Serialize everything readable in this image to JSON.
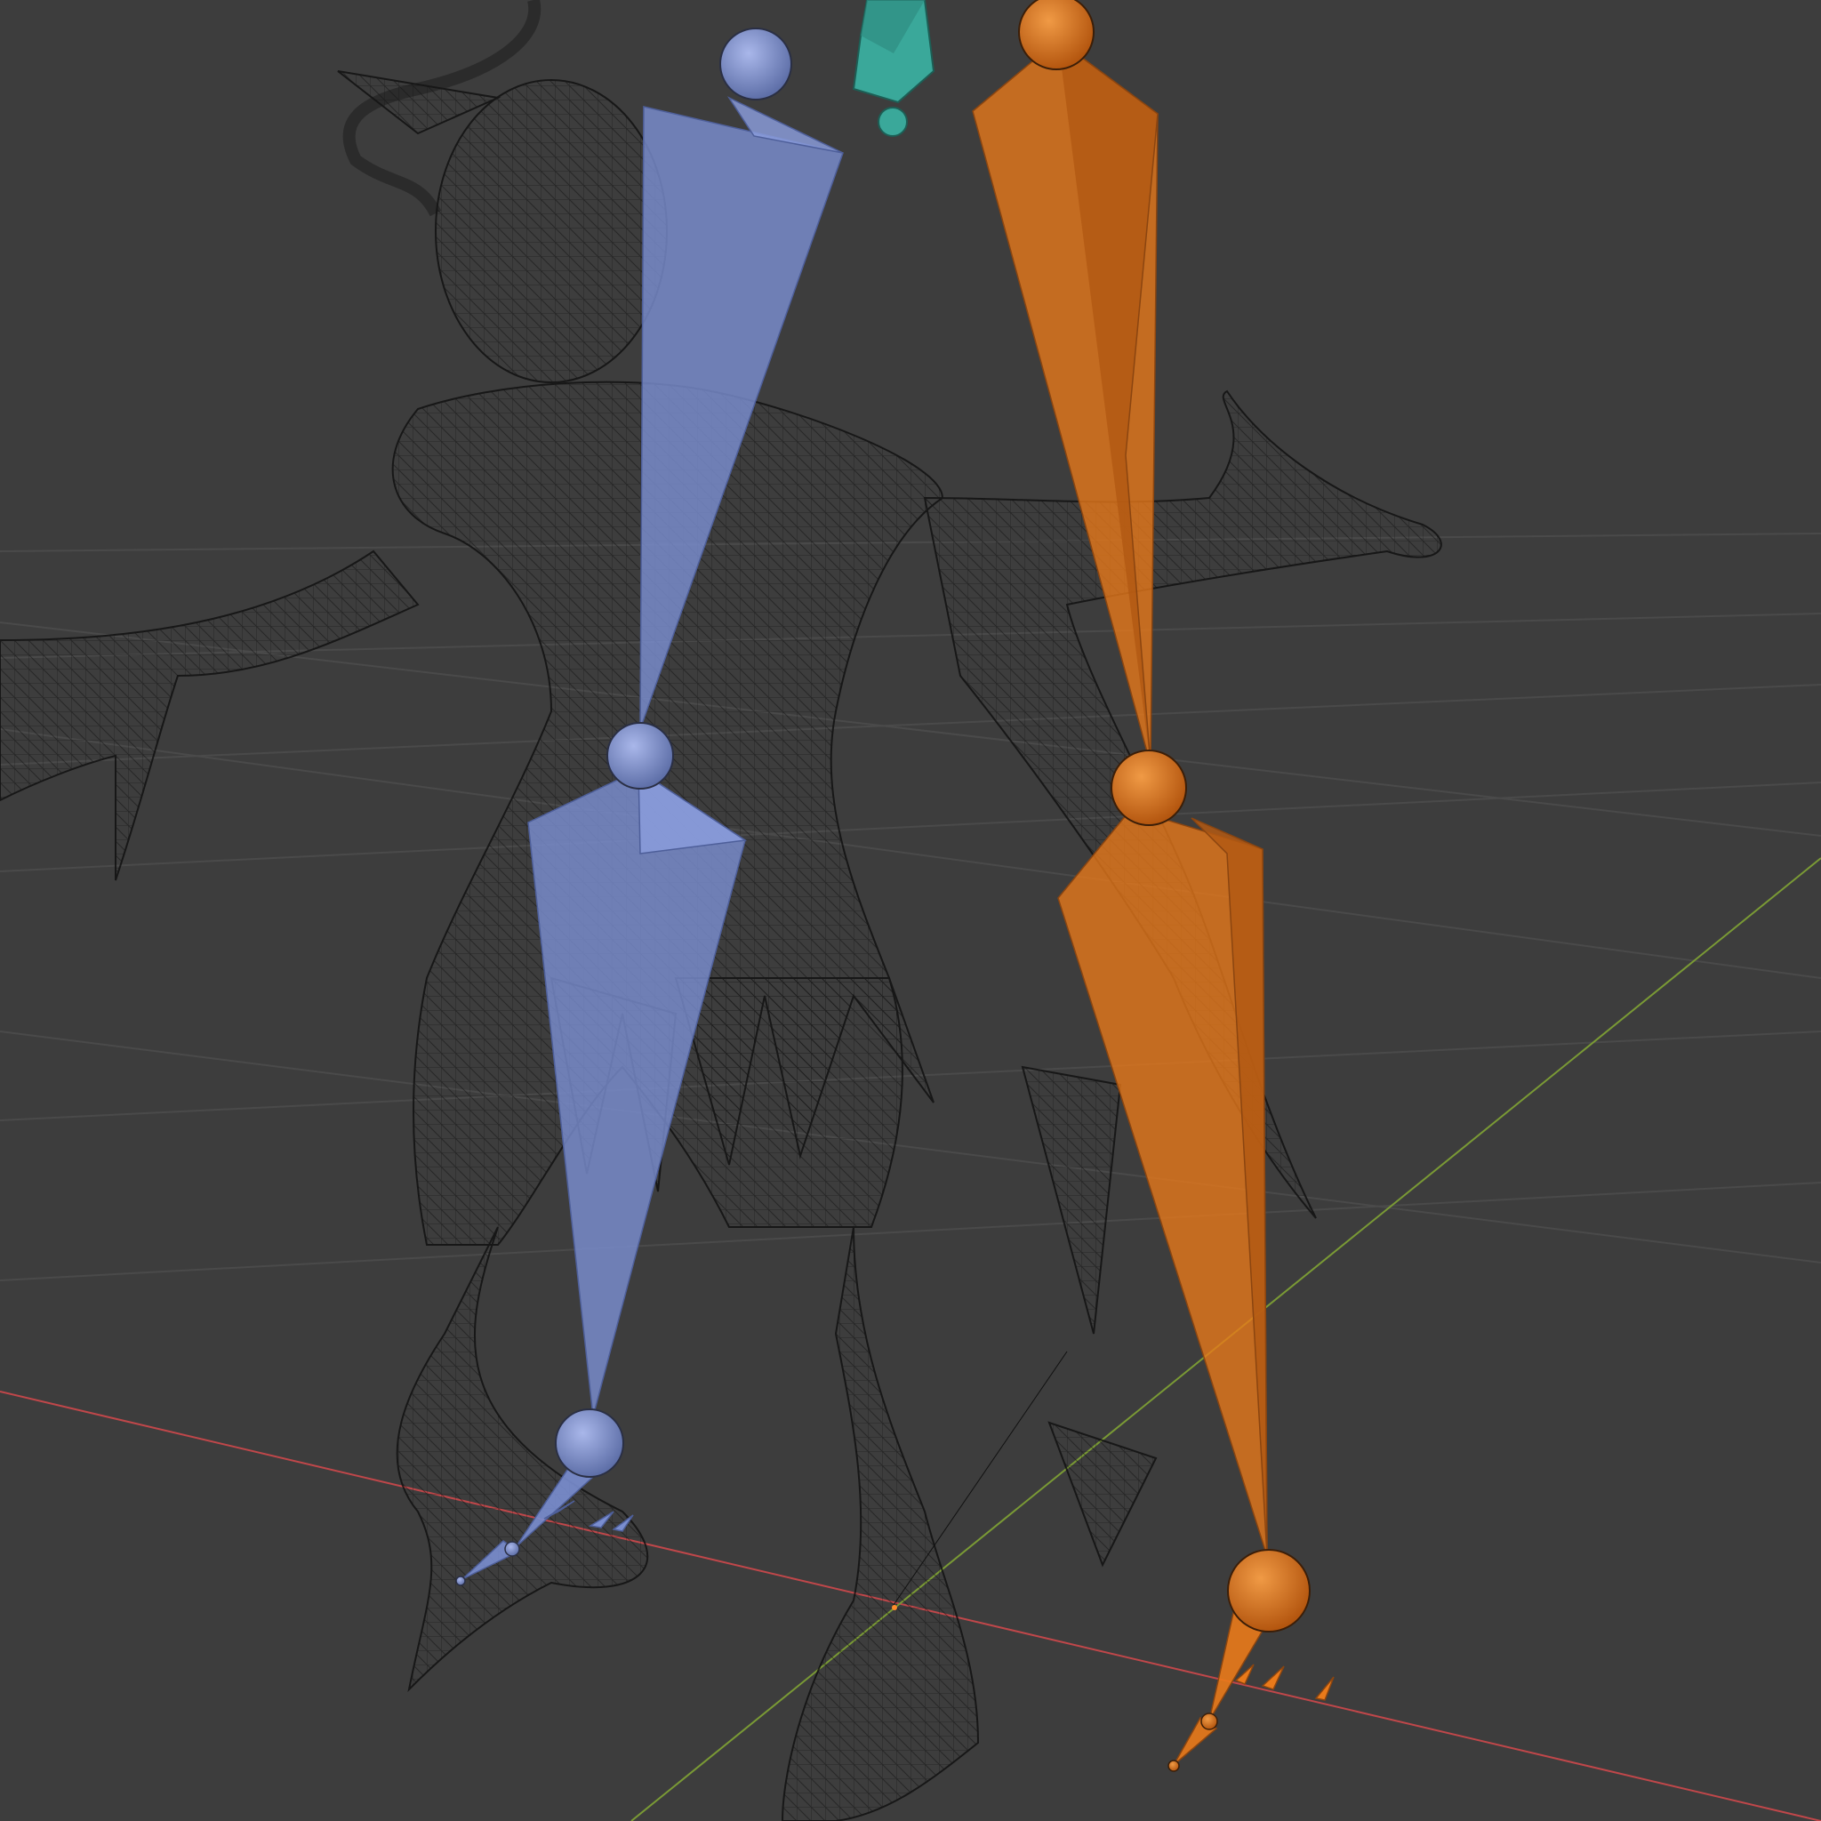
{
  "viewport": {
    "background": "#3d3d3d",
    "grid_color": "#4a4a4a",
    "x_axis_color": "#c0474a",
    "y_axis_color": "#7a9a35",
    "wire_color": "#111111"
  },
  "bones": {
    "left_leg_color": "#7a8ed0",
    "right_leg_color": "#ea7a1a",
    "root_color": "#3aa89a"
  },
  "icons": {
    "origin": "origin-dot-icon"
  }
}
